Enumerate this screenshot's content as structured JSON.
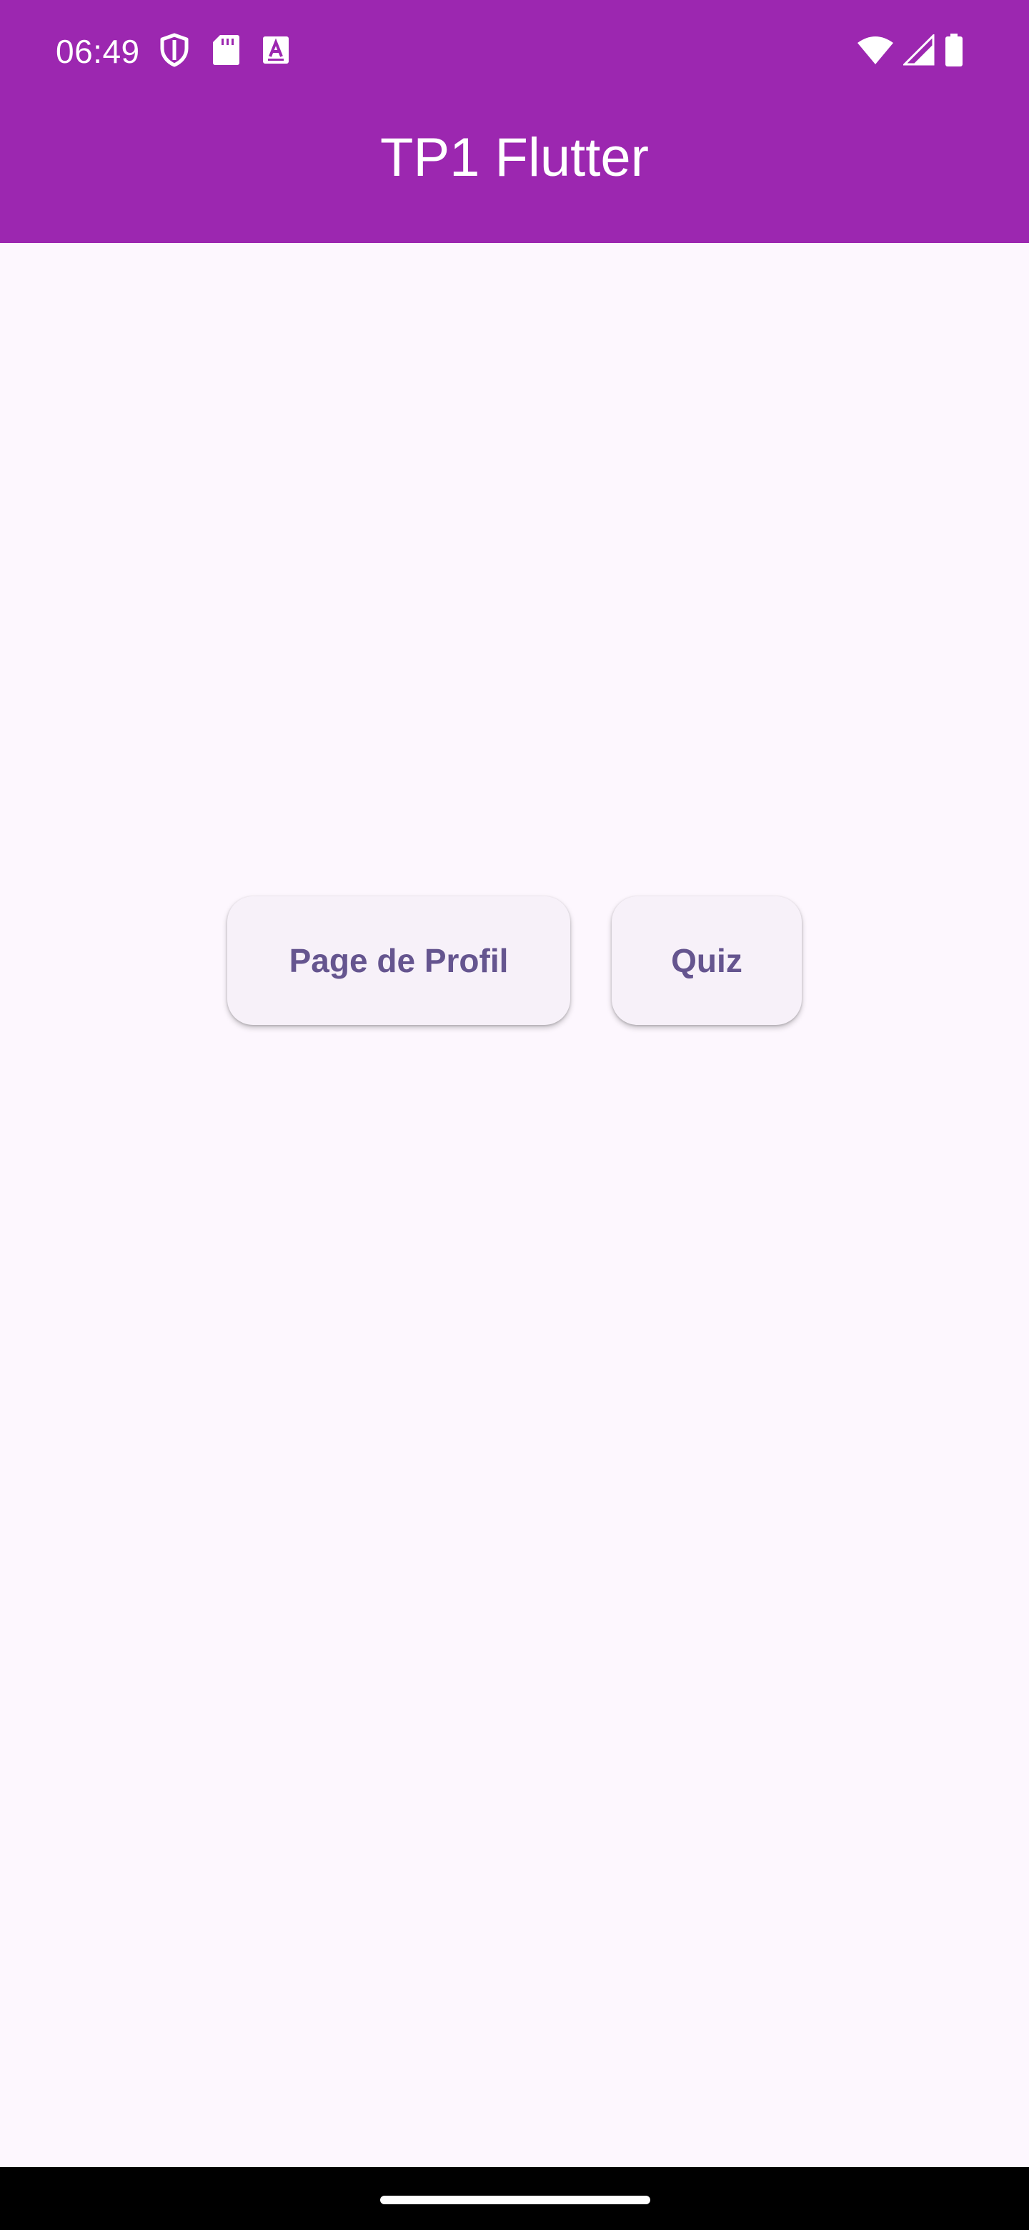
{
  "status_bar": {
    "time": "06:49",
    "left_icons": [
      "shield-icon",
      "sd-card-icon",
      "keyboard-a-icon"
    ],
    "right_icons": [
      "wifi-icon",
      "cell-signal-icon",
      "battery-icon"
    ],
    "background": "#9c27b0"
  },
  "app_bar": {
    "title": "TP1 Flutter",
    "background": "#9c27b0",
    "text_color": "#ffffff"
  },
  "main": {
    "buttons": [
      {
        "label": "Page de Profil"
      },
      {
        "label": "Quiz"
      }
    ],
    "background": "#fdf7fe",
    "button_background": "#f7f1f9",
    "button_text_color": "#65558f"
  },
  "nav_bar": {
    "background": "#000000"
  }
}
